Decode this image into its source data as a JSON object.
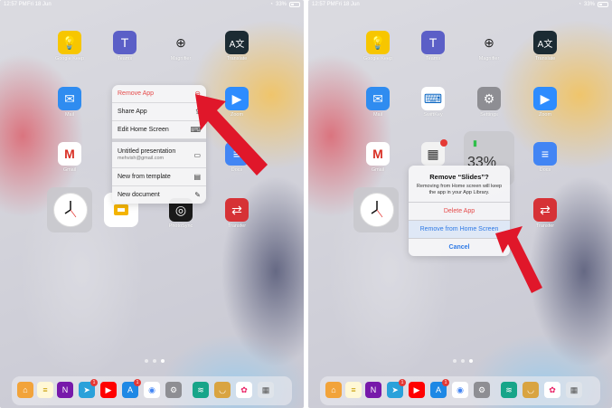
{
  "statusbar": {
    "time": "12:57 PM",
    "date": "Fri 18 Jun",
    "battery": "33%"
  },
  "left": {
    "apps": [
      {
        "name": "Google Keep"
      },
      {
        "name": "Teams"
      },
      {
        "name": "Magnifier"
      },
      {
        "name": "Translate"
      },
      {
        "name": "Mail"
      },
      {
        "name": "Gmail"
      },
      {
        "name": "PhotoSync"
      },
      {
        "name": "Transfer"
      },
      {
        "name": "Zoom"
      },
      {
        "name": "Docs"
      }
    ],
    "menu": {
      "remove": "Remove App",
      "share": "Share App",
      "edit": "Edit Home Screen",
      "presentation_title": "Untitled presentation",
      "presentation_account": "mehvish@gmail.com",
      "new_template": "New from template",
      "new_document": "New document"
    }
  },
  "right": {
    "apps": [
      {
        "name": "Google Keep"
      },
      {
        "name": "Teams"
      },
      {
        "name": "Magnifier"
      },
      {
        "name": "Translate"
      },
      {
        "name": "Mail"
      },
      {
        "name": "SwiftKey"
      },
      {
        "name": "Settings"
      },
      {
        "name": "Zoom"
      },
      {
        "name": "Gmail"
      },
      {
        "name": "Docs"
      },
      {
        "name": "Transfer"
      }
    ],
    "widget_text": "33%",
    "dialog": {
      "title": "Remove “Slides”?",
      "message": "Removing from Home screen will keep the app in your App Library.",
      "delete": "Delete App",
      "remove_home": "Remove from Home Screen",
      "cancel": "Cancel"
    }
  },
  "dock_badges": {
    "telegram": "1",
    "appstore": "1"
  },
  "colors": {
    "red": "#e54b4b",
    "blue": "#2f7ae5",
    "arrow": "#e0172a"
  }
}
